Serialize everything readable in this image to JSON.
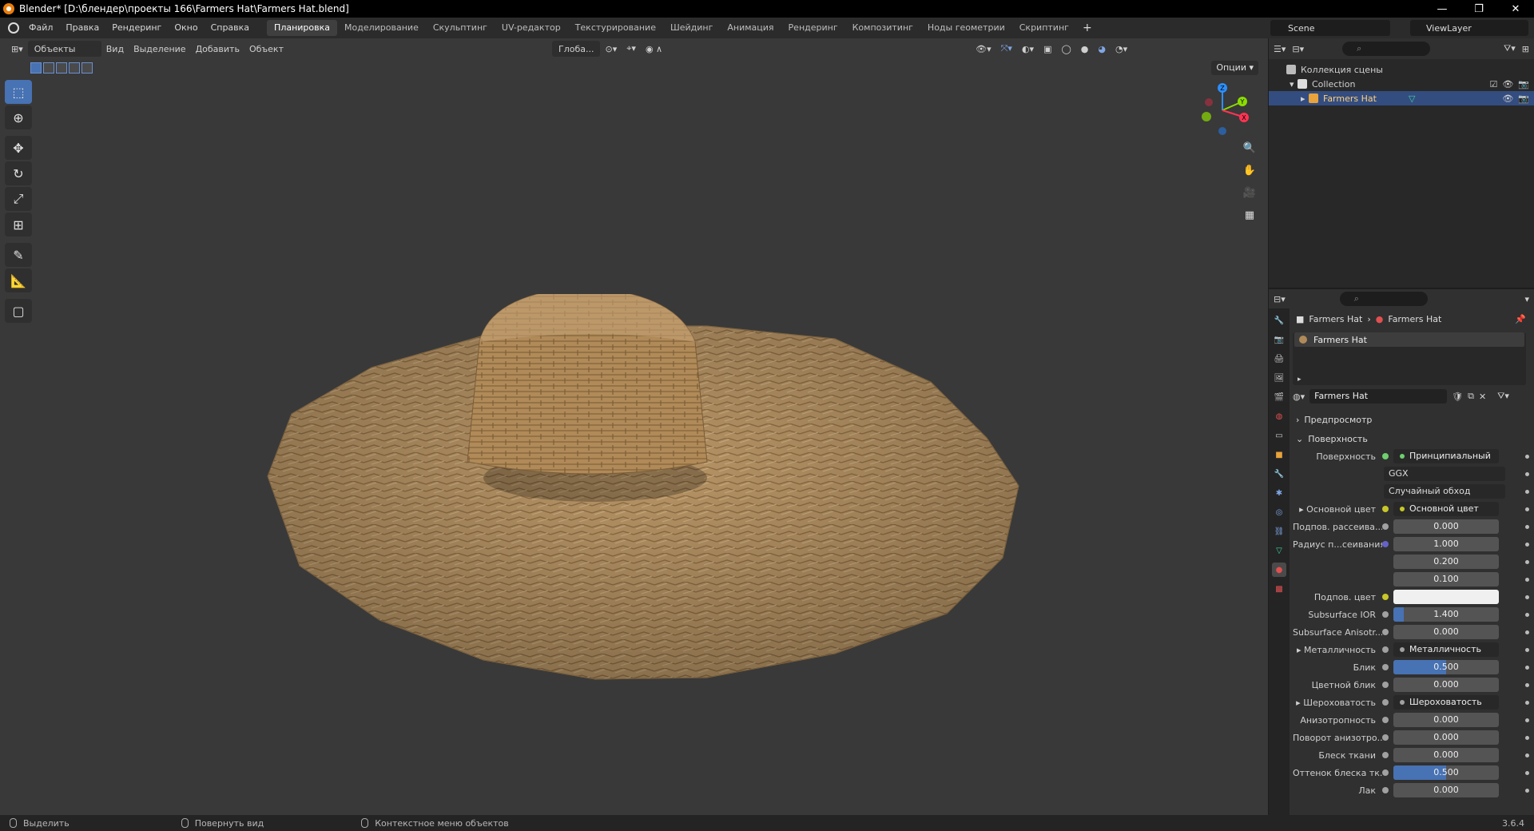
{
  "window": {
    "title": "Blender* [D:\\блендер\\проекты 166\\Farmers Hat\\Farmers Hat.blend]",
    "minimize": "—",
    "restore": "❐",
    "close": "✕"
  },
  "menu": [
    "Файл",
    "Правка",
    "Рендеринг",
    "Окно",
    "Справка"
  ],
  "workspaces": [
    {
      "label": "Планировка",
      "active": true
    },
    {
      "label": "Моделирование"
    },
    {
      "label": "Скульптинг"
    },
    {
      "label": "UV-редактор"
    },
    {
      "label": "Текстурирование"
    },
    {
      "label": "Шейдинг"
    },
    {
      "label": "Анимация"
    },
    {
      "label": "Рендеринг"
    },
    {
      "label": "Композитинг"
    },
    {
      "label": "Ноды геометрии"
    },
    {
      "label": "Скриптинг"
    }
  ],
  "scene": {
    "name": "Scene",
    "view_layer": "ViewLayer"
  },
  "viewport_header": {
    "mode": "Объекты",
    "view": "Вид",
    "select": "Выделение",
    "add": "Добавить",
    "object": "Объект",
    "orientation": "Глоба...",
    "options": "Опции"
  },
  "gizmo": {
    "x": "X",
    "y": "Y",
    "z": "Z"
  },
  "outliner": {
    "root": "Коллекция сцены",
    "collection": "Collection",
    "object": "Farmers Hat"
  },
  "properties": {
    "breadcrumb_object": "Farmers Hat",
    "breadcrumb_material": "Farmers Hat",
    "slot_name": "Farmers Hat",
    "material_name": "Farmers Hat",
    "panel_preview": "Предпросмотр",
    "panel_surface": "Поверхность",
    "rows": [
      {
        "label": "Поверхность",
        "value": "Принципиальный BSDF",
        "type": "link",
        "dot": "#6ecf6e"
      },
      {
        "type": "drop",
        "value": "GGX"
      },
      {
        "type": "drop",
        "value": "Случайный обход"
      },
      {
        "label": "Основной цвет",
        "value": "Основной цвет",
        "type": "link",
        "dot": "#c7c729",
        "arrow": true
      },
      {
        "label": "Подпов. рассеива...",
        "value": "0.000",
        "type": "num",
        "dot": "#a1a1a1",
        "fill": 0
      },
      {
        "label": "Радиус п...сеивания",
        "value": "1.000",
        "type": "num",
        "dot": "#6363c7",
        "fill": 0
      },
      {
        "type": "sub",
        "value": "0.200"
      },
      {
        "type": "sub",
        "value": "0.100"
      },
      {
        "label": "Подпов. цвет",
        "type": "color",
        "dot": "#c7c729",
        "color": "#f0f0f0"
      },
      {
        "label": "Subsurface IOR",
        "value": "1.400",
        "type": "num",
        "dot": "#a1a1a1",
        "fill": 0.1
      },
      {
        "label": "Subsurface Anisotr...",
        "value": "0.000",
        "type": "num",
        "dot": "#a1a1a1",
        "fill": 0
      },
      {
        "label": "Металличность",
        "value": "Металличность",
        "type": "link",
        "dot": "#a1a1a1",
        "arrow": true
      },
      {
        "label": "Блик",
        "value": "0.500",
        "type": "num",
        "dot": "#a1a1a1",
        "fill": 0.5
      },
      {
        "label": "Цветной блик",
        "value": "0.000",
        "type": "num",
        "dot": "#a1a1a1",
        "fill": 0
      },
      {
        "label": "Шероховатость",
        "value": "Шероховатость",
        "type": "link",
        "dot": "#a1a1a1",
        "arrow": true
      },
      {
        "label": "Анизотропность",
        "value": "0.000",
        "type": "num",
        "dot": "#a1a1a1",
        "fill": 0
      },
      {
        "label": "Поворот анизотро...",
        "value": "0.000",
        "type": "num",
        "dot": "#a1a1a1",
        "fill": 0
      },
      {
        "label": "Блеск ткани",
        "value": "0.000",
        "type": "num",
        "dot": "#a1a1a1",
        "fill": 0
      },
      {
        "label": "Оттенок блеска тк...",
        "value": "0.500",
        "type": "num",
        "dot": "#a1a1a1",
        "fill": 0.5
      },
      {
        "label": "Лак",
        "value": "0.000",
        "type": "num",
        "dot": "#a1a1a1",
        "fill": 0
      }
    ]
  },
  "status": {
    "select": "Выделить",
    "rotate": "Повернуть вид",
    "context": "Контекстное меню объектов",
    "version": "3.6.4"
  }
}
